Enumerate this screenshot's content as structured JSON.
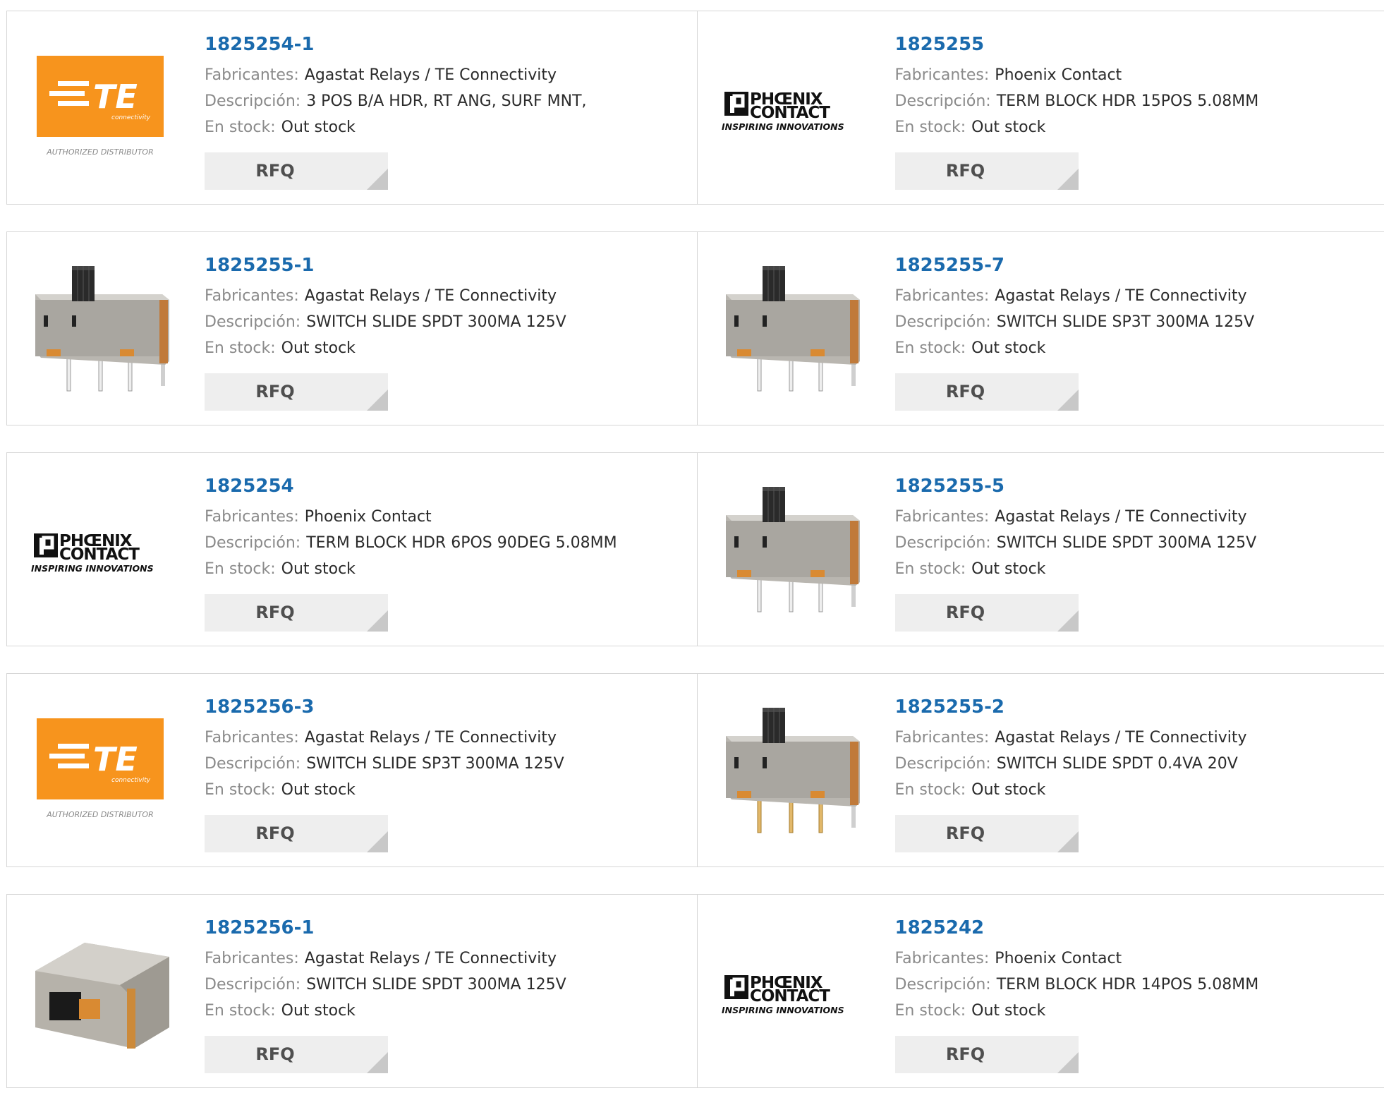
{
  "labels": {
    "manufacturer": "Fabricantes:",
    "description": "Descripción:",
    "stock": "En stock:"
  },
  "rfq_label": "RFQ",
  "te_logo": {
    "brand": "TE",
    "sub": "connectivity",
    "tagline": "AUTHORIZED DISTRIBUTOR",
    "color": "#f7941d"
  },
  "phoenix_logo": {
    "line1": "PHŒNIX",
    "line2": "CONTACT",
    "tagline": "INSPIRING INNOVATIONS"
  },
  "products": [
    {
      "part": "1825254-1",
      "manufacturer": "Agastat Relays / TE Connectivity",
      "description": "3 POS B/A HDR, RT ANG, SURF MNT,",
      "stock": "Out stock",
      "image": "te-logo"
    },
    {
      "part": "1825255",
      "manufacturer": "Phoenix Contact",
      "description": "TERM BLOCK HDR 15POS 5.08MM",
      "stock": "Out stock",
      "image": "phoenix-logo"
    },
    {
      "part": "1825255-1",
      "manufacturer": "Agastat Relays / TE Connectivity",
      "description": "SWITCH SLIDE SPDT 300MA 125V",
      "stock": "Out stock",
      "image": "slide-switch"
    },
    {
      "part": "1825255-7",
      "manufacturer": "Agastat Relays / TE Connectivity",
      "description": "SWITCH SLIDE SP3T 300MA 125V",
      "stock": "Out stock",
      "image": "slide-switch"
    },
    {
      "part": "1825254",
      "manufacturer": "Phoenix Contact",
      "description": "TERM BLOCK HDR 6POS 90DEG 5.08MM",
      "stock": "Out stock",
      "image": "phoenix-logo"
    },
    {
      "part": "1825255-5",
      "manufacturer": "Agastat Relays / TE Connectivity",
      "description": "SWITCH SLIDE SPDT 300MA 125V",
      "stock": "Out stock",
      "image": "slide-switch"
    },
    {
      "part": "1825256-3",
      "manufacturer": "Agastat Relays / TE Connectivity",
      "description": "SWITCH SLIDE SP3T 300MA 125V",
      "stock": "Out stock",
      "image": "te-logo"
    },
    {
      "part": "1825255-2",
      "manufacturer": "Agastat Relays / TE Connectivity",
      "description": "SWITCH SLIDE SPDT 0.4VA 20V",
      "stock": "Out stock",
      "image": "slide-switch-gold"
    },
    {
      "part": "1825256-1",
      "manufacturer": "Agastat Relays / TE Connectivity",
      "description": "SWITCH SLIDE SPDT 300MA 125V",
      "stock": "Out stock",
      "image": "slide-switch-side"
    },
    {
      "part": "1825242",
      "manufacturer": "Phoenix Contact",
      "description": "TERM BLOCK HDR 14POS 5.08MM",
      "stock": "Out stock",
      "image": "phoenix-logo"
    }
  ]
}
